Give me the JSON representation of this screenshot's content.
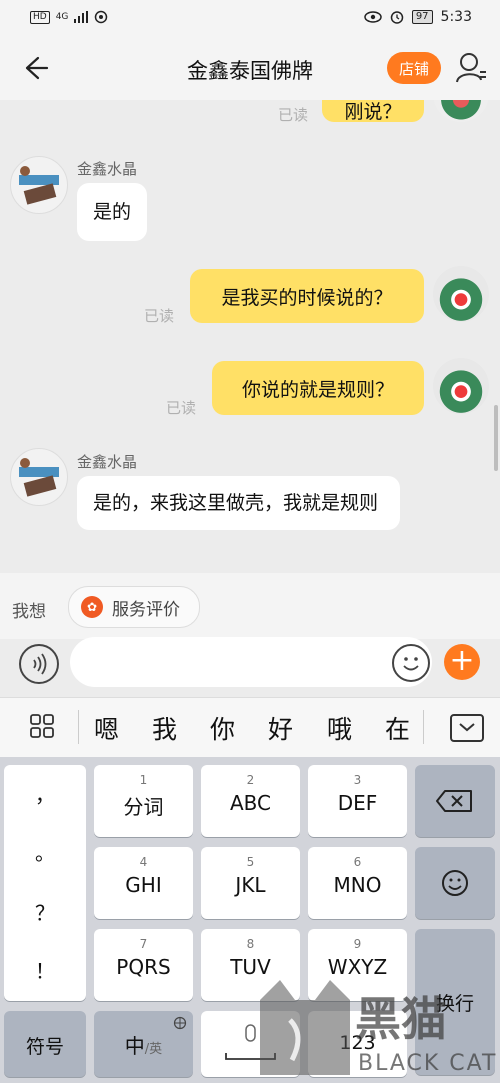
{
  "status": {
    "net": "4G",
    "battery": "97",
    "time": "5:33"
  },
  "header": {
    "title": "金鑫泰国佛牌",
    "shop_label": "店铺"
  },
  "chat": {
    "top_partial_text": "刚说？",
    "messages": [
      {
        "side": "in",
        "sender": "金鑫水晶",
        "text": "是的"
      },
      {
        "side": "out",
        "text": "是我买的时候说的？",
        "status": "已读"
      },
      {
        "side": "out",
        "text": "你说的就是规则？",
        "status": "已读"
      },
      {
        "side": "in",
        "sender": "金鑫水晶",
        "text": "是的，来我这里做壳，我就是规则"
      }
    ],
    "first_read": "已读",
    "avatar_text": "金鑫水晶"
  },
  "quick": {
    "label": "我想",
    "chip": "服务评价"
  },
  "candidates": [
    "嗯",
    "我",
    "你",
    "好",
    "哦",
    "在"
  ],
  "keyboard": {
    "punct": [
      "，",
      "。",
      "？",
      "！"
    ],
    "rows": [
      [
        {
          "num": "1",
          "label": "分词"
        },
        {
          "num": "2",
          "label": "ABC"
        },
        {
          "num": "3",
          "label": "DEF"
        }
      ],
      [
        {
          "num": "4",
          "label": "GHI"
        },
        {
          "num": "5",
          "label": "JKL"
        },
        {
          "num": "6",
          "label": "MNO"
        }
      ],
      [
        {
          "num": "7",
          "label": "PQRS"
        },
        {
          "num": "8",
          "label": "TUV"
        },
        {
          "num": "9",
          "label": "WXYZ"
        }
      ]
    ],
    "symbols": "符号",
    "lang_main": "中",
    "lang_alt": "/英",
    "num_key": "123",
    "enter": "换行"
  },
  "watermark": {
    "cn": "黑猫",
    "en": "BLACK CAT"
  },
  "colors": {
    "accent": "#ff7a1f",
    "bubble_out": "#ffe066"
  }
}
